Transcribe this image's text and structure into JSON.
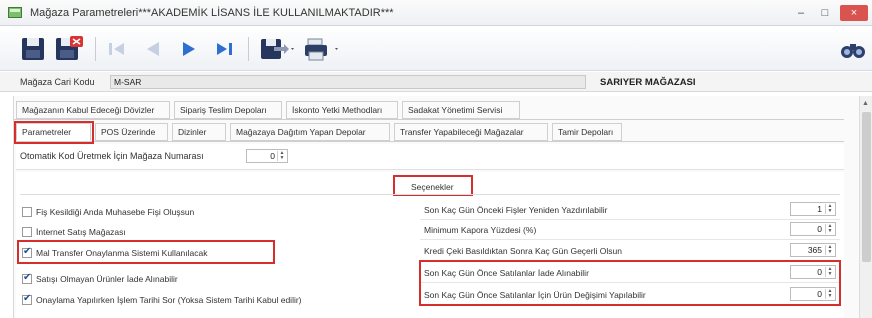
{
  "window": {
    "title": "Mağaza Parametreleri***AKADEMİK LİSANS İLE KULLANILMAKTADIR***",
    "minimize_label": "–",
    "maximize_label": "□",
    "close_label": "×"
  },
  "toolbar": {
    "icons": [
      "save-icon",
      "save-delete-icon",
      "first-record-icon",
      "previous-record-icon",
      "next-record-icon",
      "last-record-icon",
      "export-icon",
      "print-icon",
      "search-binoculars-icon"
    ]
  },
  "info": {
    "store_code_label": "Mağaza Cari Kodu",
    "store_code_value": "M-SAR",
    "store_name": "SARIYER MAĞAZASI"
  },
  "tabs": {
    "row1": [
      "Mağazanın Kabul Edeceği Dövizler",
      "Sipariş Teslim Depoları",
      "İskonto Yetki Methodları",
      "Sadakat Yönetimi Servisi"
    ],
    "row2": [
      "Parametreler",
      "POS Üzerinde",
      "Dizinler",
      "Mağazaya Dağıtım Yapan Depolar",
      "Transfer Yapabileceği Mağazalar",
      "Tamir Depoları"
    ],
    "active": "Parametreler"
  },
  "params": {
    "auto_code_label": "Otomatik Kod Üretmek İçin Mağaza Numarası",
    "auto_code_value": "0"
  },
  "section": {
    "title": "Seçenekler"
  },
  "options_left": [
    {
      "label": "Fiş Kesildiği Anda Muhasebe Fişi Oluşsun",
      "checked": false
    },
    {
      "label": "İnternet Satış Mağazası",
      "checked": false
    },
    {
      "label": "Mal Transfer Onaylanma Sistemi Kullanılacak",
      "checked": true
    },
    {
      "label": "Satışı Olmayan Ürünler İade Alınabilir",
      "checked": true
    },
    {
      "label": "Onaylama Yapılırken İşlem Tarihi Sor (Yoksa Sistem Tarihi Kabul edilir)",
      "checked": true
    }
  ],
  "options_right": [
    {
      "label": "Son Kaç Gün Önceki Fişler Yeniden Yazdırılabilir",
      "value": "1"
    },
    {
      "label": "Minimum Kapora Yüzdesi (%)",
      "value": "0"
    },
    {
      "label": "Kredi Çeki Basıldıktan Sonra Kaç Gün Geçerli Olsun",
      "value": "365"
    },
    {
      "label": "Son Kaç Gün Önce Satılanlar İade Alınabilir",
      "value": "0"
    },
    {
      "label": "Son Kaç Gün Önce Satılanlar İçin Ürün Değişimi Yapılabilir",
      "value": "0"
    }
  ],
  "colors": {
    "highlight": "#d62d2d",
    "close_button": "#d9534f"
  }
}
